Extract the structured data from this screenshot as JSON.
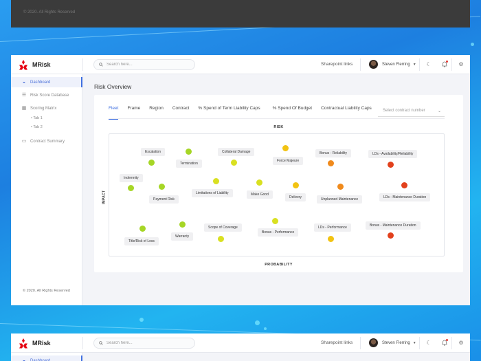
{
  "previous_frame": {
    "copyright": "© 2020. All Rights Reserved"
  },
  "app": {
    "brand": "MRisk"
  },
  "header": {
    "search_placeholder": "Search here...",
    "sharepoint_links": "Sharepoint links",
    "user_name": "Steven Flerring"
  },
  "sidebar": {
    "items": [
      {
        "label": "Dashboard",
        "icon": "dashboard-gauge-icon",
        "active": true
      },
      {
        "label": "Risk Score Database",
        "icon": "database-icon",
        "active": false
      },
      {
        "label": "Scoring Matrix",
        "icon": "grid-matrix-icon",
        "active": false
      },
      {
        "label": "Contract Summary",
        "icon": "book-icon",
        "active": false
      }
    ],
    "sub_items": [
      "Tab 1",
      "Tab 2"
    ],
    "copyright": "© 2020. All Rights Reserved"
  },
  "page": {
    "title": "Risk Overview"
  },
  "tabs": [
    {
      "label": "Fleet",
      "active": true
    },
    {
      "label": "Frame",
      "active": false
    },
    {
      "label": "Region",
      "active": false
    },
    {
      "label": "Contract",
      "active": false
    },
    {
      "label": "% Spend of Term Liability Caps",
      "active": false
    },
    {
      "label": "% Spend Of Budget",
      "active": false
    },
    {
      "label": "Contractual Liability Caps",
      "active": false
    }
  ],
  "contract_select": {
    "placeholder": "Select contract number"
  },
  "matrix": {
    "title": "RISK",
    "y_label": "IMPACT",
    "x_label": "PROBABILITY",
    "colors": {
      "low": "#a6d626",
      "medium_low": "#d9e021",
      "medium": "#f2c312",
      "medium_high": "#f08a1c",
      "high": "#e2411d"
    },
    "risks": [
      {
        "label": "Escalation",
        "level": "low"
      },
      {
        "label": "Termination",
        "level": "low"
      },
      {
        "label": "Collateral Damage",
        "level": "medium_low"
      },
      {
        "label": "Force Majeure",
        "level": "medium"
      },
      {
        "label": "Bonus - Reliability",
        "level": "medium_high"
      },
      {
        "label": "LDs - Availability/Reliability",
        "level": "high"
      },
      {
        "label": "Indemnity",
        "level": "low"
      },
      {
        "label": "Payment Risk",
        "level": "low"
      },
      {
        "label": "Limitations of Liability",
        "level": "medium_low"
      },
      {
        "label": "Make Good",
        "level": "medium_low"
      },
      {
        "label": "Delivery",
        "level": "medium"
      },
      {
        "label": "Unplanned Maintenance",
        "level": "medium_high"
      },
      {
        "label": "LDs - Maintenance Duration",
        "level": "high"
      },
      {
        "label": "Title/Risk of Loss",
        "level": "low"
      },
      {
        "label": "Warranty",
        "level": "low"
      },
      {
        "label": "Scope of Coverage",
        "level": "medium_low"
      },
      {
        "label": "Bonus - Performance",
        "level": "medium_low"
      },
      {
        "label": "LDs - Performance",
        "level": "medium"
      },
      {
        "label": "Bonus - Maintenance Duration",
        "level": "high"
      }
    ]
  }
}
